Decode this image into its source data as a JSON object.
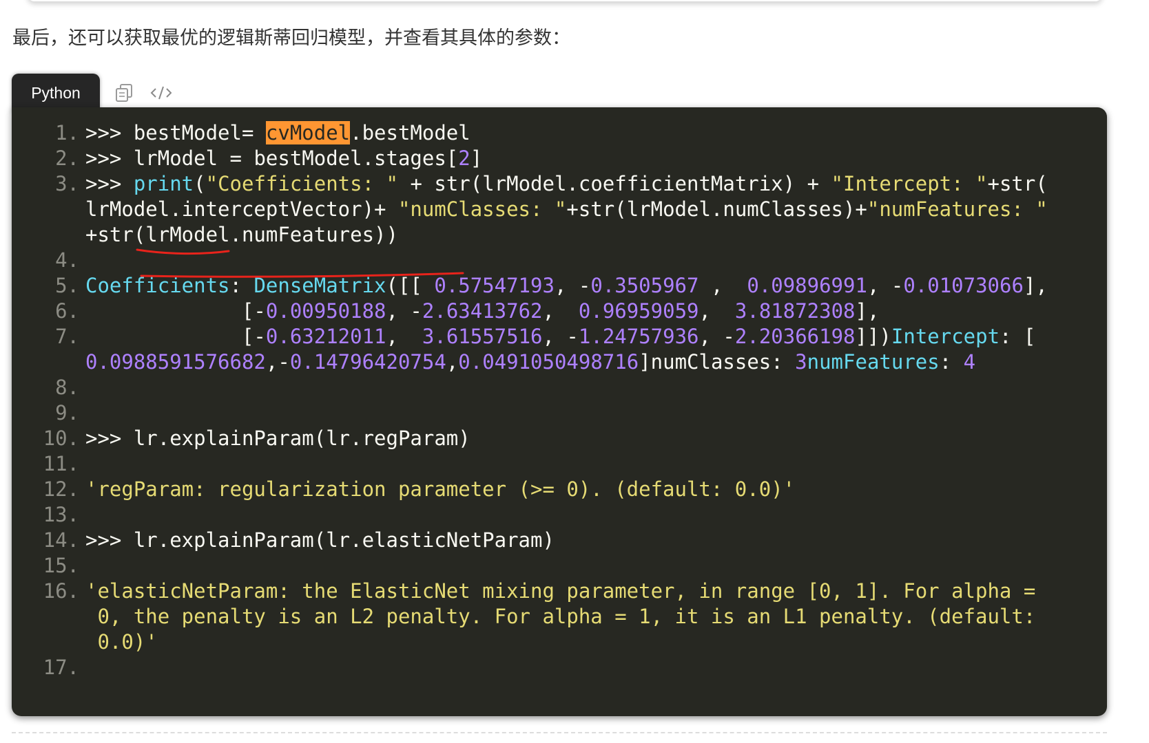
{
  "article": {
    "intro": "最后，还可以获取最优的逻辑斯蒂回归模型，并查看其具体的参数："
  },
  "code_block": {
    "language": "Python",
    "toolbar": {
      "copy_icon": "copy-icon",
      "view_source_icon": "code-brackets-icon"
    },
    "colors": {
      "background": "#272822",
      "text": "#f8f8f2",
      "keyword": "#66d9ef",
      "string": "#e6db74",
      "number": "#ae81ff",
      "line_number": "#8c8c84",
      "highlight": "#ff9632",
      "annotation": "#e8231b"
    },
    "highlighted_term": "cvModel",
    "line_numbers": [
      "1.",
      "2.",
      "3.",
      "4.",
      "5.",
      "6.",
      "7.",
      "8.",
      "9.",
      "10.",
      "11.",
      "12.",
      "13.",
      "14.",
      "15.",
      "16.",
      "17."
    ],
    "code": {
      "l1_prompt": ">>> ",
      "l1_var": "bestModel",
      "l1_eq": "= ",
      "l1_hl": "cvModel",
      "l1_rest": ".bestModel",
      "l2_prompt": ">>> ",
      "l2_code": "lrModel = bestModel.stages[",
      "l2_idx": "2",
      "l2_end": "]",
      "l3_prompt": ">>> ",
      "l3_print": "print",
      "l3_open": "(",
      "l3_s1": "\"Coefficients: \"",
      "l3_mid1": " + str(lrModel.coefficientMatrix) + ",
      "l3_s2": "\"Intercept: \"",
      "l3_mid2": "+str(",
      "l3b_a": "lrModel.interceptVector)+ ",
      "l3b_s": "\"numClasses: \"",
      "l3b_b": "+str(lrModel.numClasses)+",
      "l3b_s2": "\"numFeatures: \"",
      "l3c": "+str(lrModel.numFeatures))",
      "l5_key": "Coefficients",
      "l5_colon": ": ",
      "l5_cls": "DenseMatrix",
      "l5_open": "([[ ",
      "l5_n1": "0.57547193",
      "l5_c1": ", -",
      "l5_n2": "0.3505967",
      "l5_c2": " ,  ",
      "l5_n3": "0.09896991",
      "l5_c3": ", -",
      "l5_n4": "0.01073066",
      "l5_end": "],",
      "l6_pre": "             [-",
      "l6_n1": "0.00950188",
      "l6_c1": ", -",
      "l6_n2": "2.63413762",
      "l6_c2": ",  ",
      "l6_n3": "0.96959059",
      "l6_c3": ",  ",
      "l6_n4": "3.81872308",
      "l6_end": "],",
      "l7_pre": "             [-",
      "l7_n1": "0.63212011",
      "l7_c1": ",  ",
      "l7_n2": "3.61557516",
      "l7_c2": ", -",
      "l7_n3": "1.24757936",
      "l7_c3": ", -",
      "l7_n4": "2.20366198",
      "l7_end": "]])",
      "l7_key": "Intercept",
      "l7_colon": ": [",
      "l7b_n1": "0.0988591576682",
      "l7b_c1": ",-",
      "l7b_n2": "0.14796420754",
      "l7b_c2": ",",
      "l7b_n3": "0.0491050498716",
      "l7b_close": "]numClasses: ",
      "l7b_n4": "3",
      "l7b_key": "numFeatures",
      "l7b_colon": ": ",
      "l7b_n5": "4",
      "l10": ">>> lr.explainParam(lr.regParam)",
      "l12": "'regParam: regularization parameter (>= 0). (default: 0.0)'",
      "l14": ">>> lr.explainParam(lr.elasticNetParam)",
      "l16a": "'elasticNetParam: the ElasticNet mixing parameter, in range [0, 1]. For alpha =",
      "l16b": " 0, the penalty is an L2 penalty. For alpha = 1, it is an L1 penalty. (default:",
      "l16c": " 0.0)'"
    }
  }
}
